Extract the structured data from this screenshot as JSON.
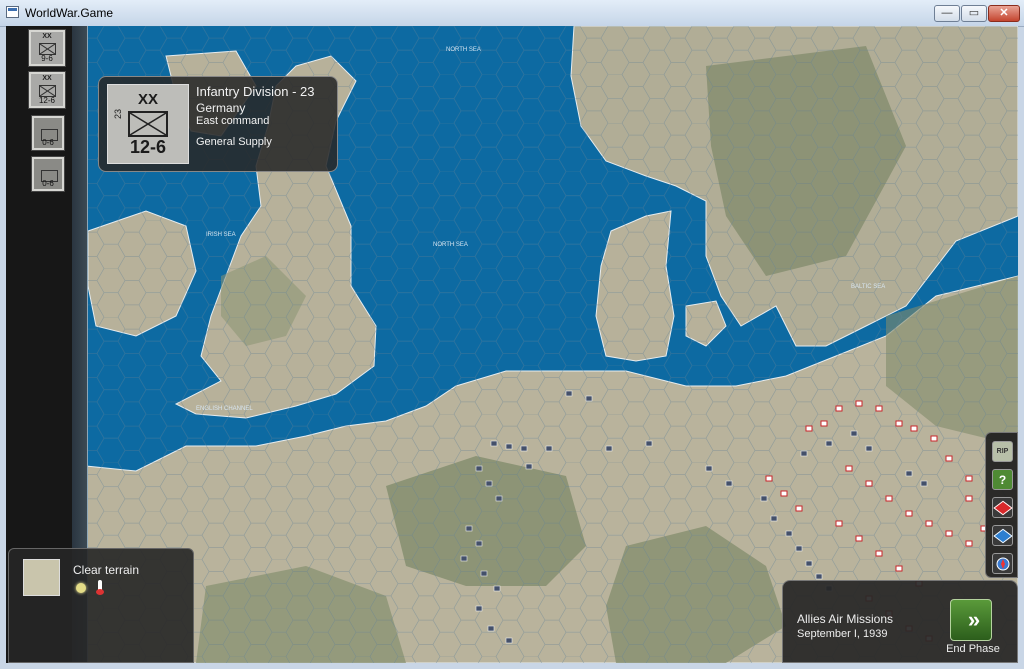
{
  "window": {
    "title": "WorldWar.Game",
    "min": "—",
    "max": "▭",
    "close": "✕"
  },
  "unit_list": [
    {
      "size": "XX",
      "strength": "9-6"
    },
    {
      "size": "XX",
      "strength": "12-6"
    },
    {
      "size": "",
      "strength": "0-6"
    },
    {
      "size": "",
      "strength": "0-6"
    }
  ],
  "unit_info": {
    "size": "XX",
    "id": "23",
    "strength": "12-6",
    "name": "Infantry Division - 23",
    "nation": "Germany",
    "command": "East command",
    "supply": "General Supply"
  },
  "terrain": {
    "name": "Clear terrain",
    "weather_icon": "sun-icon",
    "temp_icon": "thermometer-icon"
  },
  "right_toolbar": {
    "rip": "RIP",
    "help": "?",
    "icons": [
      "rip-icon",
      "help-icon",
      "red-box-icon",
      "blue-box-icon",
      "compass-icon"
    ]
  },
  "phase": {
    "title": "Allies Air Missions",
    "date": "September I, 1939",
    "end_label": "End Phase",
    "end_glyph": "»"
  },
  "map": {
    "sea_labels": [
      "NORTH SEA",
      "NORTH SEA",
      "IRISH SEA",
      "ENGLISH CHANNEL",
      "BALTIC SEA"
    ],
    "colors": {
      "sea": "#0d6aa2",
      "land": "#b7b19a",
      "forest": "#7f8a69",
      "axis": "#44506a",
      "allies": "#c8262a"
    }
  }
}
